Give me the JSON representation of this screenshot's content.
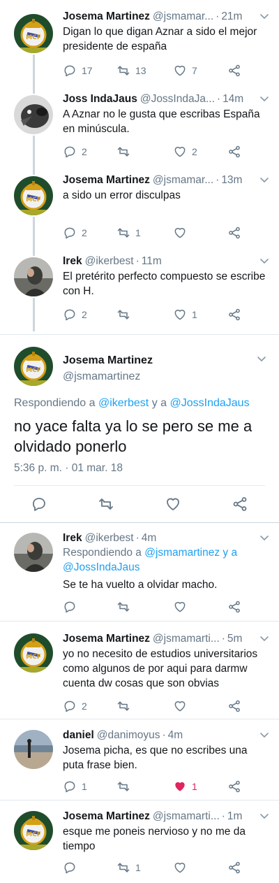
{
  "colors": {
    "accent": "#1da1f2",
    "muted": "#657786",
    "like": "#e0245e",
    "line": "#ccd6dd"
  },
  "tweets": [
    {
      "name": "Josema Martinez",
      "handle": "@jsmamar...",
      "time": "21m",
      "text": "Digan lo que digan  Aznar a sido el mejor presidente de españa",
      "replies": "17",
      "retweets": "13",
      "likes": "7",
      "avatar": "real-madrid-crest"
    },
    {
      "name": "Joss IndaJaus",
      "handle": "@JossIndaJa...",
      "time": "14m",
      "text": "A Aznar no le gusta que escribas España en minúscula.",
      "replies": "2",
      "retweets": "",
      "likes": "2",
      "avatar": "bw-bird"
    },
    {
      "name": "Josema Martinez",
      "handle": "@jsmamar...",
      "time": "13m",
      "text": "a sido un error disculpas",
      "replies": "2",
      "retweets": "1",
      "likes": "",
      "avatar": "real-madrid-crest"
    },
    {
      "name": "Irek",
      "handle": "@ikerbest",
      "time": "11m",
      "text": "El pretérito perfecto compuesto se escribe con H.",
      "replies": "2",
      "retweets": "",
      "likes": "1",
      "avatar": "person-photo"
    }
  ],
  "focused": {
    "name": "Josema Martinez",
    "handle": "@jsmamartinez",
    "reply_prefix": "Respondiendo a ",
    "mention1": "@ikerbest",
    "joiner": " y a ",
    "mention2": "@JossIndaJaus",
    "text": "no yace falta ya lo se pero se me a olvidado ponerlo",
    "timestamp": "5:36 p. m. · 01 mar. 18"
  },
  "replies": [
    {
      "name": "Irek",
      "handle": "@ikerbest",
      "time": "4m",
      "reply_prefix": "Respondiendo a ",
      "mention1": "@jsmamartinez",
      "joiner": " y a ",
      "mention2": "@JossIndaJaus",
      "text": "Se te ha vuelto a olvidar macho.",
      "replies": "",
      "retweets": "",
      "likes": ""
    },
    {
      "name": "Josema Martinez",
      "handle": "@jsmamarti...",
      "time": "5m",
      "text": "yo no necesito de estudios universitarios como algunos de por aqui para darmw cuenta dw cosas que son obvias",
      "replies": "2",
      "retweets": "",
      "likes": ""
    },
    {
      "name": "daniel",
      "handle": "@danimoyus",
      "time": "4m",
      "text": "Josema picha, es que no escribes una puta frase bien.",
      "replies": "1",
      "retweets": "",
      "likes": "1",
      "liked": true
    },
    {
      "name": "Josema Martinez",
      "handle": "@jsmamarti...",
      "time": "1m",
      "text": "esque me poneis nervioso y no me da tiempo",
      "replies": "",
      "retweets": "1",
      "likes": ""
    }
  ]
}
